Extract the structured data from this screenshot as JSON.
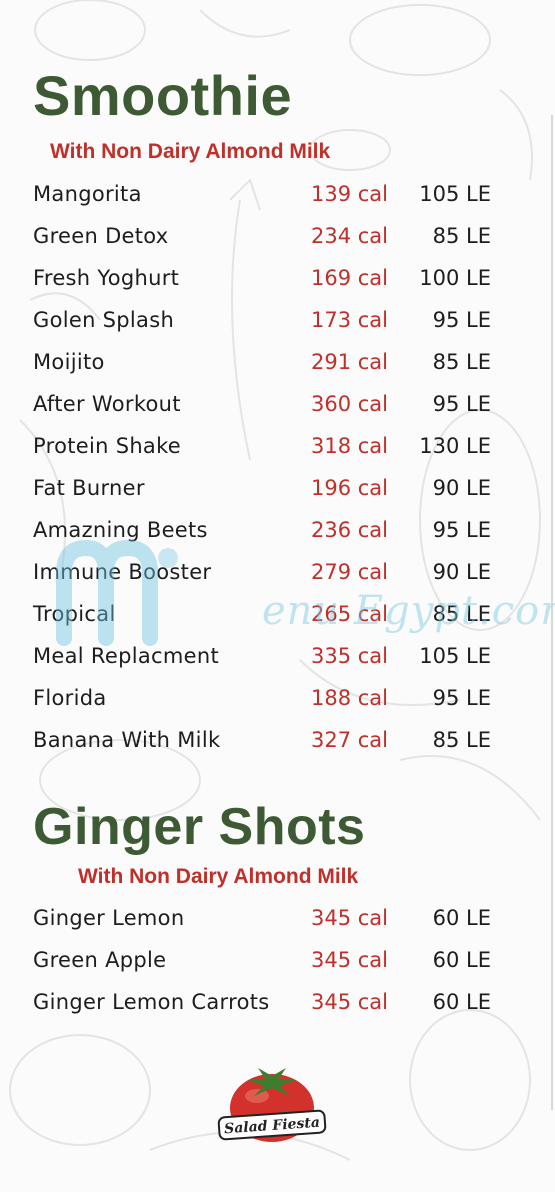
{
  "sections": [
    {
      "title": "Smoothie",
      "subtitle": "With Non Dairy Almond Milk",
      "items": [
        {
          "name": "Mangorita",
          "cal": "139 cal",
          "price": "105 LE"
        },
        {
          "name": "Green Detox",
          "cal": "234 cal",
          "price": "85 LE"
        },
        {
          "name": "Fresh Yoghurt",
          "cal": "169 cal",
          "price": "100 LE"
        },
        {
          "name": "Golen Splash",
          "cal": "173 cal",
          "price": "95 LE"
        },
        {
          "name": "Moijito",
          "cal": "291 cal",
          "price": "85 LE"
        },
        {
          "name": "After Workout",
          "cal": "360 cal",
          "price": "95 LE"
        },
        {
          "name": "Protein Shake",
          "cal": "318 cal",
          "price": "130 LE"
        },
        {
          "name": "Fat Burner",
          "cal": "196 cal",
          "price": "90 LE"
        },
        {
          "name": "Amazning Beets",
          "cal": "236 cal",
          "price": "95 LE"
        },
        {
          "name": "Immune Booster",
          "cal": "279 cal",
          "price": "90 LE"
        },
        {
          "name": "Tropical",
          "cal": "265 cal",
          "price": "85 LE"
        },
        {
          "name": "Meal Replacment",
          "cal": "335 cal",
          "price": "105 LE"
        },
        {
          "name": "Florida",
          "cal": "188 cal",
          "price": "95 LE"
        },
        {
          "name": "Banana With Milk",
          "cal": "327 cal",
          "price": "85 LE"
        }
      ]
    },
    {
      "title": "Ginger Shots",
      "subtitle": "With Non Dairy Almond Milk",
      "items": [
        {
          "name": "Ginger Lemon",
          "cal": "345 cal",
          "price": "60 LE"
        },
        {
          "name": "Green Apple",
          "cal": "345 cal",
          "price": "60 LE"
        },
        {
          "name": "Ginger Lemon Carrots",
          "cal": "345 cal",
          "price": "60 LE"
        }
      ]
    }
  ],
  "watermark": "enu Egypt.com",
  "logo": {
    "text": "Salad Fiesta",
    "icon": "tomato-icon"
  },
  "colors": {
    "title": "#3d5a34",
    "accent": "#c0302a",
    "text": "#1d1d1d"
  }
}
